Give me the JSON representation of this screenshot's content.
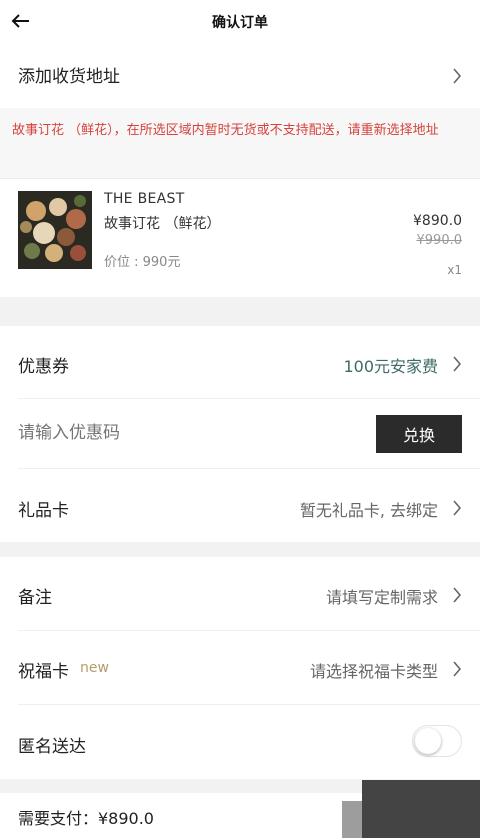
{
  "header": {
    "title": "确认订单"
  },
  "address": {
    "label": "添加收货地址"
  },
  "notice": {
    "text": "故事订花 （鲜花），在所选区域内暂时无货或不支持配送，请重新选择地址"
  },
  "product": {
    "brand": "THE BEAST",
    "name": "故事订花 （鲜花）",
    "list_price": "价位 : 990元",
    "price": "¥890.0",
    "original_price": "¥990.0",
    "quantity": "x1"
  },
  "coupon": {
    "label": "优惠券",
    "value": "100元安家费"
  },
  "promo": {
    "placeholder": "请输入优惠码",
    "button": "兑换"
  },
  "gift_card": {
    "label": "礼品卡",
    "value": "暂无礼品卡, 去绑定"
  },
  "remark": {
    "label": "备注",
    "value": "请填写定制需求"
  },
  "blessing_card": {
    "label": "祝福卡",
    "badge": "new",
    "value": "请选择祝福卡类型"
  },
  "anonymous": {
    "label": "匿名送达",
    "enabled": false
  },
  "footer": {
    "total": "需要支付：¥890.0"
  },
  "colors": {
    "notice_red": "#d6433d",
    "coupon_green": "#3e6b66",
    "badge_gold": "#b39c6b",
    "button_dark": "#2b2b2b"
  }
}
